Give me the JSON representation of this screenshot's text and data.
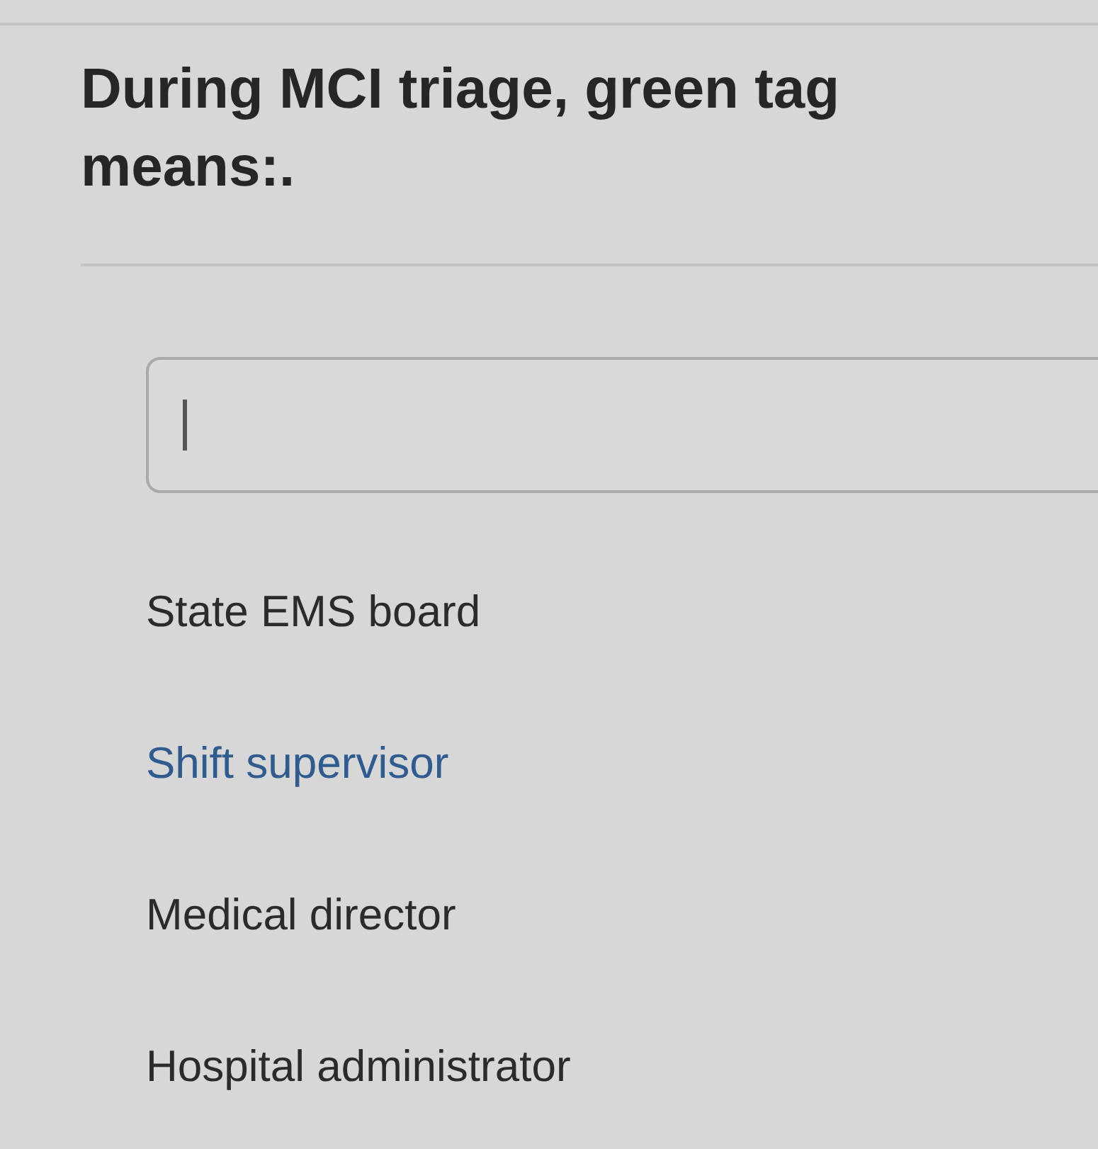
{
  "question": "During MCI triage, green tag means:.",
  "answer_field": {
    "focused": true
  },
  "options": [
    {
      "label": "State EMS board",
      "selected": false
    },
    {
      "label": "Shift supervisor",
      "selected": true
    },
    {
      "label": "Medical director",
      "selected": false
    },
    {
      "label": "Hospital administrator",
      "selected": false
    }
  ]
}
